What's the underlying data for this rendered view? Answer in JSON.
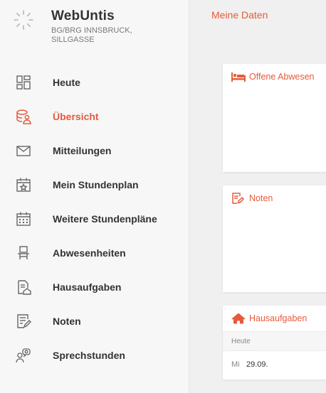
{
  "brand": {
    "title": "WebUntis",
    "subtitle_line1": "BG/BRG INNSBRUCK,",
    "subtitle_line2": "SILLGASSE"
  },
  "nav": {
    "items": [
      {
        "label": "Heute",
        "icon": "dashboard-icon",
        "active": false
      },
      {
        "label": "Übersicht",
        "icon": "student-overview-icon",
        "active": true
      },
      {
        "label": "Mitteilungen",
        "icon": "envelope-icon",
        "active": false
      },
      {
        "label": "Mein Stundenplan",
        "icon": "calendar-star-icon",
        "active": false
      },
      {
        "label": "Weitere Stundenpläne",
        "icon": "calendar-grid-icon",
        "active": false
      },
      {
        "label": "Abwesenheiten",
        "icon": "chair-icon",
        "active": false
      },
      {
        "label": "Hausaufgaben",
        "icon": "document-home-icon",
        "active": false
      },
      {
        "label": "Noten",
        "icon": "document-pen-icon",
        "active": false
      },
      {
        "label": "Sprechstunden",
        "icon": "people-chat-icon",
        "active": false
      }
    ]
  },
  "main": {
    "title": "Meine Daten",
    "cards": {
      "absences": {
        "title": "Offene Abwesen",
        "icon": "bed-icon"
      },
      "grades": {
        "title": "Noten",
        "icon": "edit-note-icon"
      },
      "homework": {
        "title": "Hausaufgaben",
        "icon": "home-icon",
        "column_header": "Heute",
        "rows": [
          {
            "day": "Mi",
            "date": "29.09."
          }
        ]
      }
    }
  },
  "colors": {
    "accent": "#e65b3b",
    "sidebar_bg": "#f7f7f7",
    "main_bg": "#f0f0f0",
    "text": "#333333"
  }
}
